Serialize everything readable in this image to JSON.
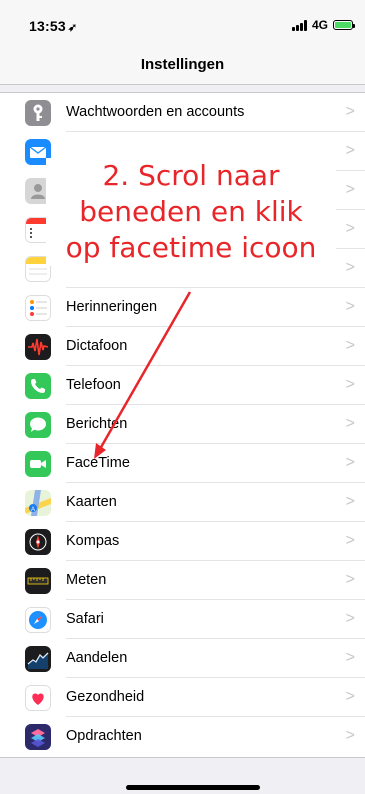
{
  "status": {
    "time": "13:53",
    "location_glyph": "➶",
    "network": "4G"
  },
  "nav": {
    "title": "Instellingen"
  },
  "rows": [
    {
      "label": "Wachtwoorden en accounts",
      "icon": "key-icon"
    },
    {
      "label": "",
      "icon": "mail-icon"
    },
    {
      "label": "",
      "icon": "contacts-icon"
    },
    {
      "label": "",
      "icon": "calendar-icon"
    },
    {
      "label": "",
      "icon": "notes-icon"
    },
    {
      "label": "Herinneringen",
      "icon": "reminders-icon"
    },
    {
      "label": "Dictafoon",
      "icon": "voice-memos-icon"
    },
    {
      "label": "Telefoon",
      "icon": "phone-icon"
    },
    {
      "label": "Berichten",
      "icon": "messages-icon"
    },
    {
      "label": "FaceTime",
      "icon": "facetime-icon"
    },
    {
      "label": "Kaarten",
      "icon": "maps-icon"
    },
    {
      "label": "Kompas",
      "icon": "compass-icon"
    },
    {
      "label": "Meten",
      "icon": "measure-icon"
    },
    {
      "label": "Safari",
      "icon": "safari-icon"
    },
    {
      "label": "Aandelen",
      "icon": "stocks-icon"
    },
    {
      "label": "Gezondheid",
      "icon": "health-icon"
    },
    {
      "label": "Opdrachten",
      "icon": "shortcuts-icon"
    }
  ],
  "chevron": ">",
  "annotation": {
    "line1": "2. Scrol naar",
    "line2": "beneden en klik",
    "line3": "op facetime icoon",
    "color": "#e8262a"
  }
}
